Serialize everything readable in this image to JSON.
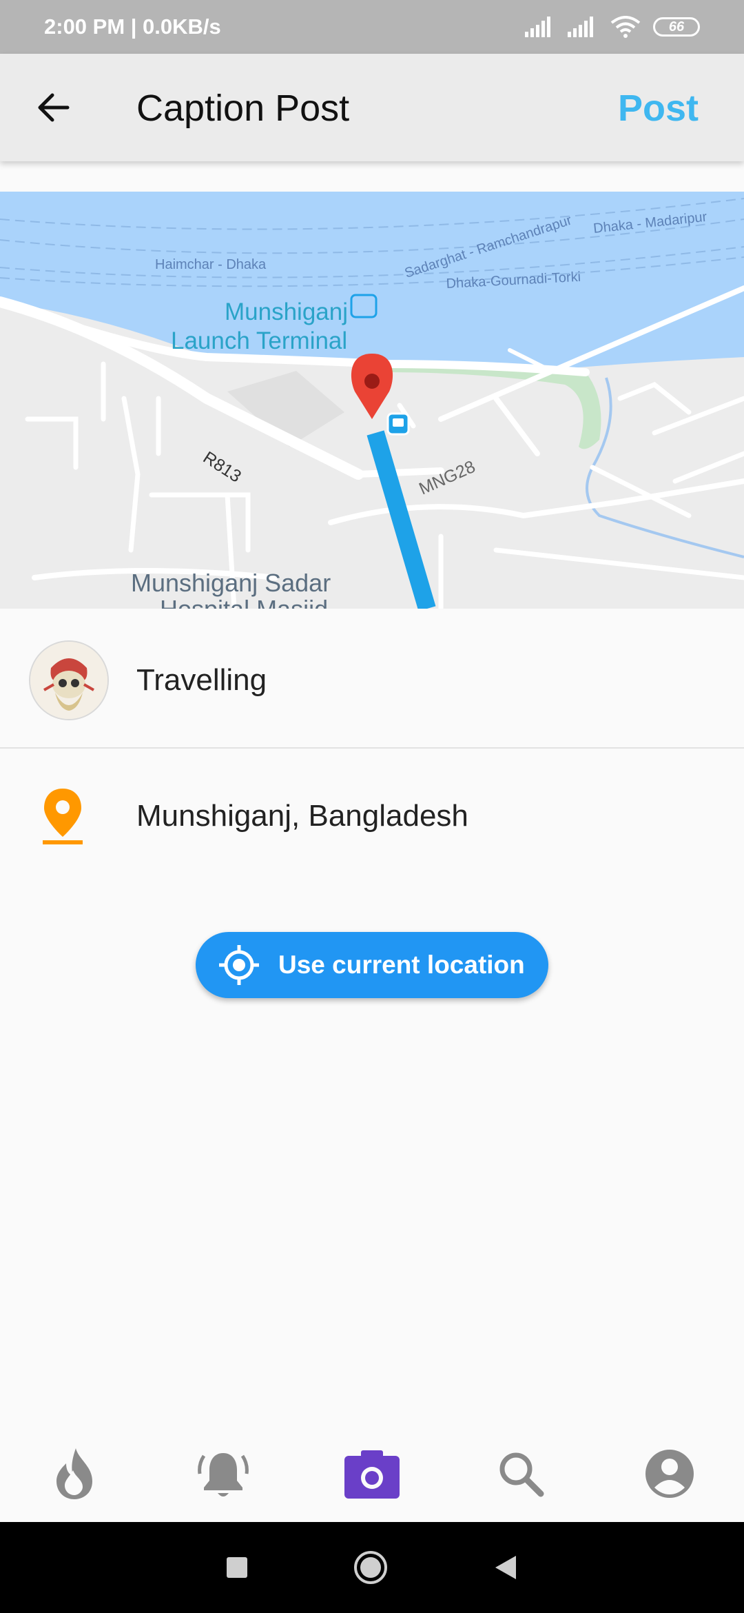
{
  "status_bar": {
    "time": "2:00 PM | 0.0KB/s",
    "battery": "66",
    "icons": [
      "signal-icon",
      "signal-icon",
      "wifi-icon",
      "battery-icon"
    ]
  },
  "app_bar": {
    "back_icon": "arrow-back-icon",
    "title": "Caption Post",
    "post_label": "Post"
  },
  "map": {
    "labels": {
      "route_1": "Sadarghat - Ramchandrapur",
      "route_2": "Dhaka - Madaripur",
      "route_3": "Haimchar - Dhaka",
      "route_4": "Dhaka-Gournadi-Torki",
      "terminal_1": "Munshiganj",
      "terminal_2": "Launch Terminal",
      "road_1": "R813",
      "road_2": "MNG28",
      "hospital": "Munshiganj Sadar",
      "hospital_2": "Hospital Masjid"
    },
    "colors": {
      "water": "#aad3fb",
      "land": "#ececec",
      "road": "#ffffff",
      "route": "#1ea2e8",
      "pin": "#ea4335"
    }
  },
  "caption_row": {
    "avatar_icon": "avatar",
    "text": "Travelling"
  },
  "location_row": {
    "icon": "location-pin-icon",
    "text": "Munshiganj, Bangladesh",
    "color": "#ff9800"
  },
  "current_location_button": {
    "icon": "gps-fixed-icon",
    "label": "Use current location",
    "color": "#2196f3"
  },
  "bottom_nav": {
    "items": [
      {
        "name": "trending-icon",
        "active": false
      },
      {
        "name": "notifications-icon",
        "active": false
      },
      {
        "name": "camera-icon",
        "active": true
      },
      {
        "name": "search-icon",
        "active": false
      },
      {
        "name": "profile-icon",
        "active": false
      }
    ],
    "active_color": "#6a3fc8",
    "inactive_color": "#8a8a8a"
  },
  "system_nav": {
    "items": [
      "recents-icon",
      "home-icon",
      "back-icon"
    ]
  }
}
